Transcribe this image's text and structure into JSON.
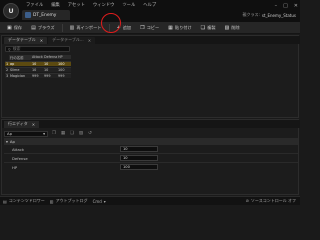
{
  "app": {
    "logo": "U"
  },
  "menu": [
    "ファイル",
    "編集",
    "アセット",
    "ウィンドウ",
    "ツール",
    "ヘルプ"
  ],
  "window_controls": [
    "–",
    "□",
    "✕"
  ],
  "asset_tab": {
    "label": "DT_Enemy"
  },
  "parent_class": {
    "label": "親クラス:",
    "value": "st_Enemy_Status"
  },
  "toolbar": {
    "save_label": "保存",
    "browse_label": "ブラウズ",
    "reimport_label": "再インポート",
    "add_label": "追加",
    "copy_label": "コピー",
    "paste_label": "貼り付け",
    "duplicate_label": "複製",
    "delete_label": "削除"
  },
  "table_panel": {
    "tab_label": "データテーブル",
    "tab2_label": "データテーブル...",
    "search_placeholder": "検索"
  },
  "grid": {
    "headers": [
      "",
      "行の名前",
      "Attack",
      "Defense",
      "HP"
    ],
    "rows": [
      {
        "index": "1",
        "name": "ap",
        "attack": "10",
        "defense": "10",
        "hp": "100"
      },
      {
        "index": "2",
        "name": "Slime",
        "attack": "10",
        "defense": "10",
        "hp": "100"
      },
      {
        "index": "3",
        "name": "Magician",
        "attack": "999",
        "defense": "999",
        "hp": "999"
      }
    ]
  },
  "row_editor": {
    "tab_label": "行エディタ",
    "selected_row": "Ap",
    "section": "Ap",
    "properties": [
      {
        "label": "Attack",
        "value": "10"
      },
      {
        "label": "Defense",
        "value": "10"
      },
      {
        "label": "HP",
        "value": "100"
      }
    ]
  },
  "statusbar": {
    "content_drawer": "コンテンツドロワー",
    "output_log": "アウトプットログ",
    "cmd": "Cmd",
    "source_control": "ソースコントロール オフ"
  },
  "colors": {
    "accent_selected_row": "#5c4a10",
    "annotation_circle": "#e01c1c"
  }
}
